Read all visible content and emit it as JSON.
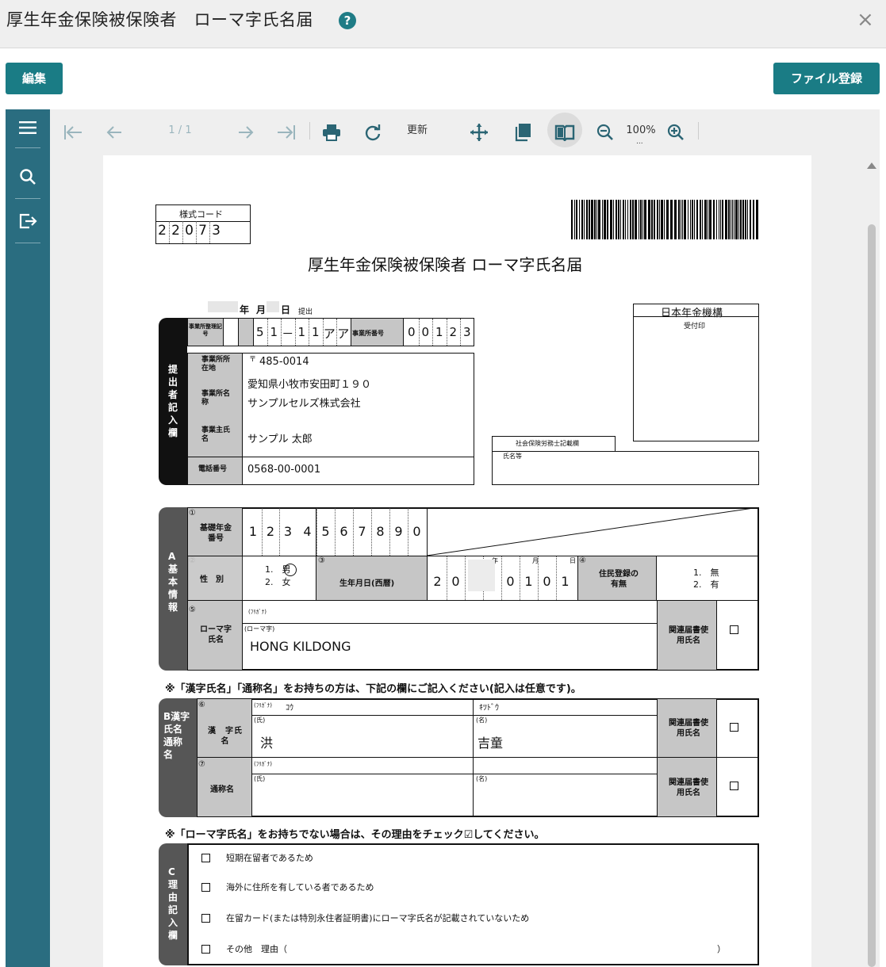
{
  "header": {
    "title": "厚生年金保険被保険者　ローマ字氏名届",
    "help_glyph": "?",
    "close_glyph": "×"
  },
  "actions": {
    "edit_label": "編集",
    "file_register_label": "ファイル登録"
  },
  "toolbar": {
    "page_indicator": "1 / 1",
    "refresh_label": "更新",
    "zoom": "100%",
    "zoom_more": "..."
  },
  "form": {
    "style_code_label": "様式コード",
    "style_code_digits": [
      "2",
      "2",
      "0",
      "7",
      "3"
    ],
    "title": "厚生年金保険被保険者 ローマ字氏名届",
    "date_year": "年",
    "date_month": "月",
    "date_day": "日",
    "date_submit": "提出",
    "jp_pension_office": "日本年金機構",
    "reception_stamp": "受付印",
    "submitter_band": "提出者記入欄",
    "office_reg_code_label": "事業所整理記号",
    "office_reg_code": [
      "5",
      "1",
      "－",
      "1",
      "1",
      "ア",
      "ア"
    ],
    "office_number_label": "事業所番号",
    "office_number": [
      "0",
      "0",
      "1",
      "2",
      "3"
    ],
    "office_address_label": "事業所所在地",
    "postal_mark": "〒",
    "postal_code": "485-0014",
    "address": "愛知県小牧市安田町１９０",
    "office_name_label": "事業所名称",
    "office_name": "サンプルセルズ株式会社",
    "owner_label": "事業主氏名",
    "owner_name": "サンプル 太郎",
    "phone_label": "電話番号",
    "phone": "0568-00-0001",
    "sharoushi_label": "社会保険労務士記載欄",
    "sharoushi_name_label": "氏名等",
    "section_a_band": "A基本情報",
    "n1": "①",
    "n2": "②",
    "n3": "③",
    "n4": "④",
    "n5": "⑤",
    "n6": "⑥",
    "n7": "⑦",
    "basic_pension_label": "基礎年金番号",
    "basic_pension_digits": [
      "1",
      "2",
      "3",
      "4",
      "5",
      "6",
      "7",
      "8",
      "9",
      "0"
    ],
    "sex_label": "性　別",
    "sex_male": "1.　男",
    "sex_female": "2.　女",
    "birth_label": "生年月日(西暦)",
    "birth_digits": [
      "2",
      "0",
      "",
      "",
      "0",
      "1",
      "0",
      "1"
    ],
    "birth_year": "年",
    "birth_month": "月",
    "birth_day": "日",
    "residence_label": "住民登録の有無",
    "residence_none": "1.　無",
    "residence_yes": "2.　有",
    "roman_label": "ローマ字氏名",
    "furigana_small": "(ﾌﾘｶﾞﾅ)",
    "roman_small": "(ローマ字)",
    "roman_name": "HONG KILDONG",
    "related_label": "関連届書使用氏名",
    "notice_kanji": "※「漢字氏名」「通称名」をお持ちの方は、下記の欄にご記入ください(記入は任意です)。",
    "section_b_band": "B漢字氏名通称名",
    "kanji_label": "漢　字氏　名",
    "kanji_furi_last": "ｺｳ",
    "kanji_furi_first": "ｷﾂﾄﾞｳ",
    "last_small": "(氏)",
    "first_small": "(名)",
    "kanji_last": "洪",
    "kanji_first": "吉童",
    "alias_label": "通称名",
    "notice_roman": "※「ローマ字氏名」をお持ちでない場合は、その理由をチェック☑してください。",
    "section_c_band": "C理由記入欄",
    "reasons": [
      "短期在留者であるため",
      "海外に住所を有している者であるため",
      "在留カード(または特別永住者証明書)にローマ字氏名が記載されていないため",
      "その他　理由（"
    ],
    "reason_close": "）"
  }
}
